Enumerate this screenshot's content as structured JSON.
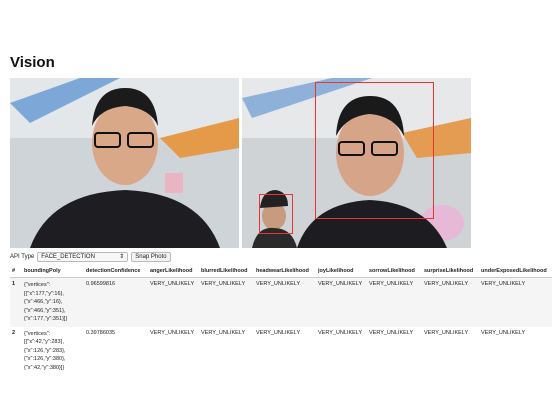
{
  "page_title": "Vision",
  "controls": {
    "api_type_label": "API Type",
    "api_type_value": "FACE_DETECTION",
    "snap_label": "Snap Photo"
  },
  "table": {
    "headers": [
      "#",
      "boundingPoly",
      "detectionConfidence",
      "angerLikelihood",
      "blurredLikelihood",
      "headwearLikelihood",
      "joyLikelihood",
      "sorrowLikelihood",
      "surpriseLikelihood",
      "underExposedLikelihood"
    ],
    "rows": [
      {
        "index": "1",
        "poly": [
          "{\"vertices\":",
          "[{\"x\":177,\"y\":16},",
          "{\"x\":466,\"y\":16},",
          "{\"x\":466,\"y\":351},",
          "{\"x\":177,\"y\":351}]}"
        ],
        "confidence": "0.96599816",
        "anger": "VERY_UNLIKELY",
        "blurred": "VERY_UNLIKELY",
        "headwear": "VERY_UNLIKELY",
        "joy": "VERY_UNLIKELY",
        "sorrow": "VERY_UNLIKELY",
        "surprise": "VERY_UNLIKELY",
        "underexposed": "VERY_UNLIKELY"
      },
      {
        "index": "2",
        "poly": [
          "{\"vertices\":",
          "[{\"x\":42,\"y\":283},",
          "{\"x\":126,\"y\":283},",
          "{\"x\":126,\"y\":380},",
          "{\"x\":42,\"y\":380}]}"
        ],
        "confidence": "0.39786035",
        "anger": "VERY_UNLIKELY",
        "blurred": "VERY_UNLIKELY",
        "headwear": "VERY_UNLIKELY",
        "joy": "VERY_UNLIKELY",
        "sorrow": "VERY_UNLIKELY",
        "surprise": "VERY_UNLIKELY",
        "underexposed": "VERY_UNLIKELY"
      }
    ]
  }
}
